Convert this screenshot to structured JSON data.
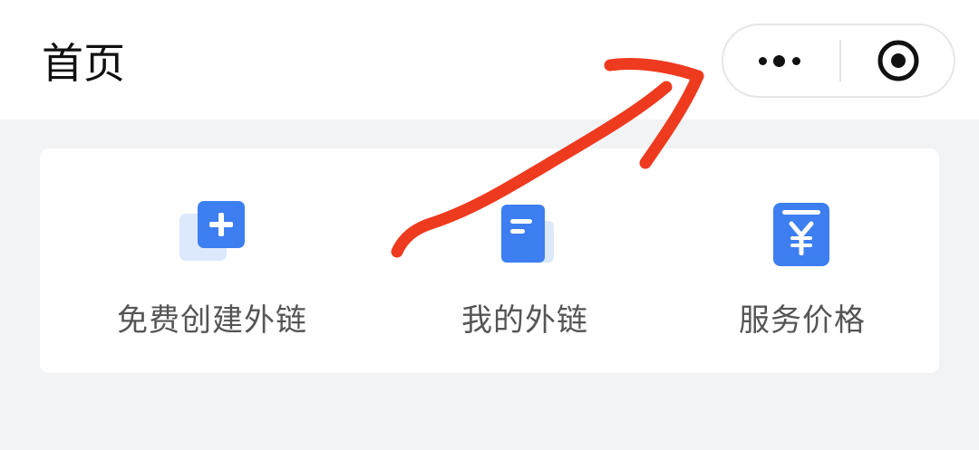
{
  "header": {
    "title": "首页"
  },
  "capsule": {
    "more_icon": "more-dots-icon",
    "close_icon": "target-circle-icon"
  },
  "actions": [
    {
      "label": "免费创建外链",
      "icon": "plus-square-icon"
    },
    {
      "label": "我的外链",
      "icon": "document-icon"
    },
    {
      "label": "服务价格",
      "icon": "yuan-receipt-icon"
    }
  ],
  "colors": {
    "accent": "#3d7ef0",
    "accent_light": "#dce8fc",
    "annotation": "#ee3a1e",
    "background": "#f2f3f5"
  }
}
